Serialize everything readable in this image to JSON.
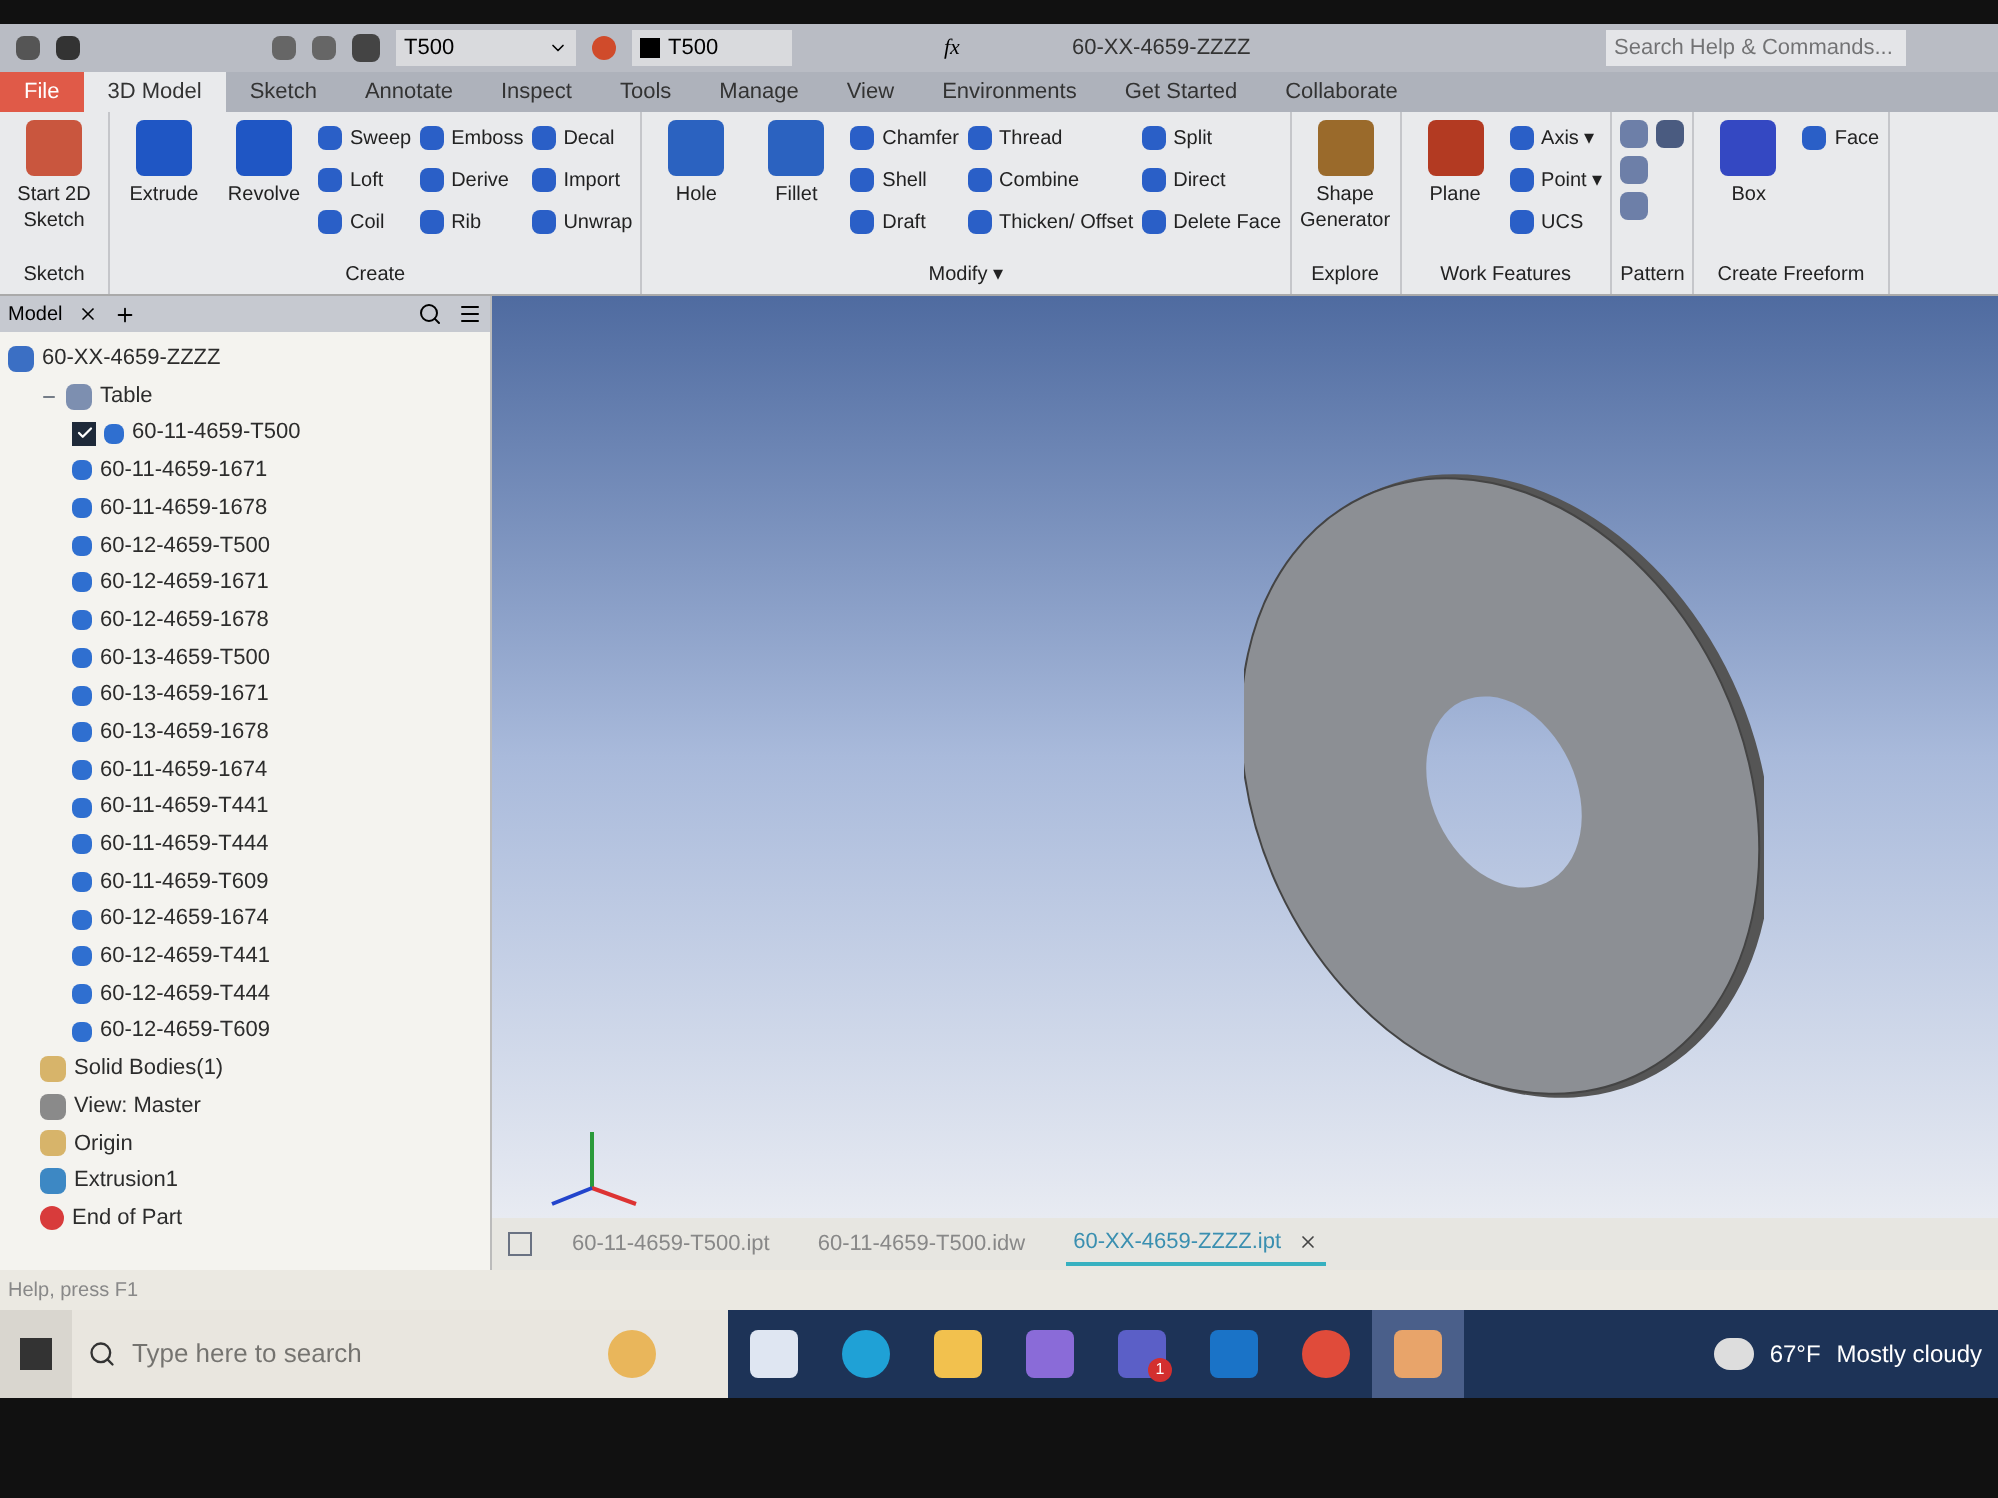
{
  "quick_access": {
    "material": "T500",
    "appearance": "T500",
    "document_title": "60-XX-4659-ZZZZ",
    "formula_label": "fx",
    "search": {
      "placeholder": "Search Help & Commands..."
    }
  },
  "tabs": [
    {
      "label": "File",
      "kind": "file",
      "selected": false
    },
    {
      "label": "3D Model",
      "kind": "tab",
      "selected": true
    },
    {
      "label": "Sketch",
      "kind": "tab",
      "selected": false
    },
    {
      "label": "Annotate",
      "kind": "tab",
      "selected": false
    },
    {
      "label": "Inspect",
      "kind": "tab",
      "selected": false
    },
    {
      "label": "Tools",
      "kind": "tab",
      "selected": false
    },
    {
      "label": "Manage",
      "kind": "tab",
      "selected": false
    },
    {
      "label": "View",
      "kind": "tab",
      "selected": false
    },
    {
      "label": "Environments",
      "kind": "tab",
      "selected": false
    },
    {
      "label": "Get Started",
      "kind": "tab",
      "selected": false
    },
    {
      "label": "Collaborate",
      "kind": "tab",
      "selected": false
    }
  ],
  "ribbon": [
    {
      "title": "Sketch",
      "kind": "commands",
      "large": [
        "Start 2D Sketch"
      ]
    },
    {
      "title": "Create",
      "kind": "commands",
      "large": [
        "Extrude",
        "Revolve"
      ],
      "columns": [
        [
          "Sweep",
          "Loft",
          "Coil"
        ],
        [
          "Emboss",
          "Derive",
          "Rib"
        ],
        [
          "Decal",
          "Import",
          "Unwrap"
        ]
      ]
    },
    {
      "title": "Modify ▾",
      "kind": "commands",
      "large": [
        "Hole",
        "Fillet"
      ],
      "columns": [
        [
          "Chamfer",
          "Shell",
          "Draft"
        ],
        [
          "Thread",
          "Combine",
          "Thicken/ Offset"
        ],
        [
          "Split",
          "Direct",
          "Delete Face"
        ]
      ]
    },
    {
      "title": "Explore",
      "kind": "commands",
      "large": [
        "Shape Generator"
      ]
    },
    {
      "title": "Work Features",
      "kind": "commands",
      "large": [
        "Plane"
      ],
      "columns": [
        [
          "Axis ▾",
          "Point ▾",
          "UCS"
        ]
      ]
    },
    {
      "title": "Pattern",
      "kind": "icon_grid"
    },
    {
      "title": "Create Freeform",
      "kind": "commands",
      "large": [
        "Box"
      ],
      "columns": [
        [
          "Face"
        ]
      ]
    }
  ],
  "browser": {
    "tab": "Model",
    "tree": [
      {
        "label": "60-XX-4659-ZZZZ",
        "kind": "part",
        "children": [
          {
            "label": "Table",
            "kind": "table",
            "expanded": true,
            "children": [
              {
                "label": "60-11-4659-T500",
                "kind": "member",
                "checked": true
              },
              {
                "label": "60-11-4659-1671",
                "kind": "member",
                "checked": false
              },
              {
                "label": "60-11-4659-1678",
                "kind": "member",
                "checked": false
              },
              {
                "label": "60-12-4659-T500",
                "kind": "member",
                "checked": false
              },
              {
                "label": "60-12-4659-1671",
                "kind": "member",
                "checked": false
              },
              {
                "label": "60-12-4659-1678",
                "kind": "member",
                "checked": false
              },
              {
                "label": "60-13-4659-T500",
                "kind": "member",
                "checked": false
              },
              {
                "label": "60-13-4659-1671",
                "kind": "member",
                "checked": false
              },
              {
                "label": "60-13-4659-1678",
                "kind": "member",
                "checked": false
              },
              {
                "label": "60-11-4659-1674",
                "kind": "member",
                "checked": false
              },
              {
                "label": "60-11-4659-T441",
                "kind": "member",
                "checked": false
              },
              {
                "label": "60-11-4659-T444",
                "kind": "member",
                "checked": false
              },
              {
                "label": "60-11-4659-T609",
                "kind": "member",
                "checked": false
              },
              {
                "label": "60-12-4659-1674",
                "kind": "member",
                "checked": false
              },
              {
                "label": "60-12-4659-T441",
                "kind": "member",
                "checked": false
              },
              {
                "label": "60-12-4659-T444",
                "kind": "member",
                "checked": false
              },
              {
                "label": "60-12-4659-T609",
                "kind": "member",
                "checked": false
              }
            ]
          },
          {
            "label": "Solid Bodies(1)",
            "kind": "folder"
          },
          {
            "label": "View: Master",
            "kind": "view"
          },
          {
            "label": "Origin",
            "kind": "folder"
          },
          {
            "label": "Extrusion1",
            "kind": "extrusion"
          },
          {
            "label": "End of Part",
            "kind": "end"
          }
        ]
      }
    ]
  },
  "document_tabs": [
    {
      "label": "60-11-4659-T500.ipt",
      "selected": false
    },
    {
      "label": "60-11-4659-T500.idw",
      "selected": false
    },
    {
      "label": "60-XX-4659-ZZZZ.ipt",
      "selected": true
    }
  ],
  "status_bar": "Help, press F1",
  "taskbar": {
    "search": {
      "placeholder": "Type here to search"
    },
    "weather": {
      "temperature": "67°F",
      "condition": "Mostly cloudy"
    },
    "apps": [
      {
        "kind": "taskview",
        "active": false
      },
      {
        "kind": "edge",
        "active": false
      },
      {
        "kind": "files",
        "active": false
      },
      {
        "kind": "studio",
        "active": false
      },
      {
        "kind": "teams",
        "active": false,
        "badge": "1"
      },
      {
        "kind": "outlook",
        "active": false
      },
      {
        "kind": "chrome",
        "active": false
      },
      {
        "kind": "inventor",
        "active": true
      }
    ]
  }
}
